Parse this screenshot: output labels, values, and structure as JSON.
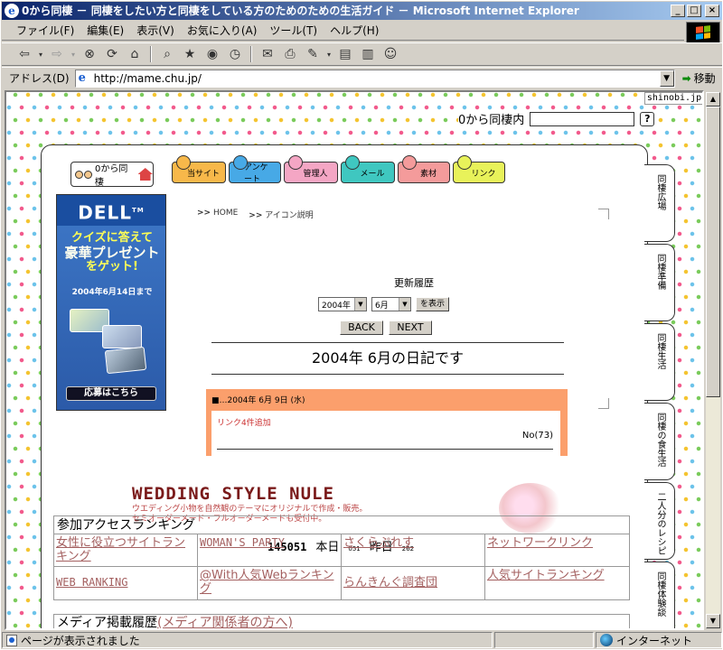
{
  "window": {
    "title": "0から同棲 － 同棲をしたい方と同棲をしている方のためのための生活ガイド － Microsoft Internet Explorer"
  },
  "menu": [
    "ファイル(F)",
    "編集(E)",
    "表示(V)",
    "お気に入り(A)",
    "ツール(T)",
    "ヘルプ(H)"
  ],
  "address": {
    "label": "アドレス(D)",
    "url": "http://mame.chu.jp/",
    "go": "移動"
  },
  "status": {
    "text": "ページが表示されました",
    "zone": "インターネット"
  },
  "page": {
    "shinobi": "shinobi.jp",
    "search_label": "0から同棲内",
    "help": "?",
    "logo": "0から同棲",
    "nav": [
      {
        "label": "当サイト",
        "color": "#f7b84a"
      },
      {
        "label": "アンケート",
        "color": "#47a9e6"
      },
      {
        "label": "管理人",
        "color": "#f4a6c4"
      },
      {
        "label": "メール",
        "color": "#3fc7c0"
      },
      {
        "label": "素材",
        "color": "#f49b9b"
      },
      {
        "label": "リンク",
        "color": "#e8f25a"
      }
    ],
    "ad": {
      "brand": "DELL",
      "tm": "TM",
      "line1": "クイズに答えて",
      "line2": "豪華プレゼント",
      "line3": "をゲット!",
      "date": "2004年6月14日まで",
      "apply": "応募はこちら"
    },
    "breadcrumb": {
      "home_marker": ">>",
      "home": "HOME",
      "icon_marker": ">>",
      "icon": "アイコン説明"
    },
    "update_history": "更新履歴",
    "year_select": "2004年",
    "month_select": "6月",
    "show_button": "を表示",
    "back": "BACK",
    "next": "NEXT",
    "month_title": "2004年 6月の日記です",
    "entry": {
      "head": "■…2004年 6月 9日 (水)",
      "text": "リンク4件追加",
      "no": "No(73)"
    },
    "banner": {
      "title": "WEDDING STYLE NULE",
      "line1": "ウエディング小物を自然観のテーマにオリジナルで作成・販売。",
      "line2": "セミオーダーメード・フルオーダーメードも受付中。"
    },
    "counter": {
      "total": "145051",
      "today_label": "本日",
      "today": "051",
      "yesterday_label": "昨日",
      "yesterday": "262"
    },
    "ranking": {
      "title": "参加アクセスランキング",
      "rows": [
        [
          "女性に役立つサイトランキング",
          "WOMAN'S PARTY",
          "さくらぷれす",
          "ネットワークリンク"
        ],
        [
          "WEB RANKING",
          "@With人気Webランキング",
          "らんきんぐ調査団",
          "人気サイトランキング"
        ]
      ]
    },
    "media": {
      "title": "メディア掲載履歴",
      "link": "(メディア関係者の方へ)"
    },
    "vtabs": [
      "同棲広場",
      "同棲準備",
      "同棲生活",
      "同棲の食生活",
      "二人分のレシピ",
      "同棲体験談"
    ]
  }
}
